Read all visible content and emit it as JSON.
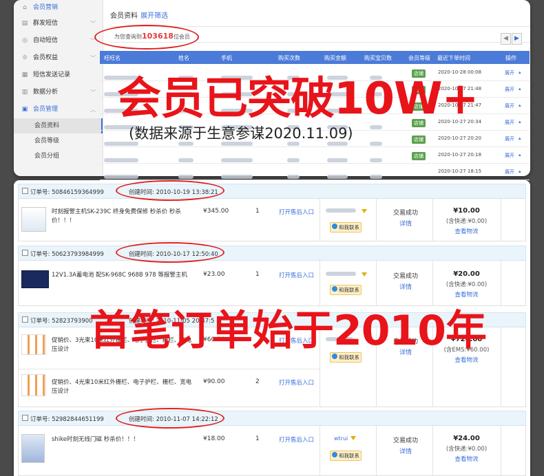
{
  "sidebar": {
    "items": [
      {
        "label": "会员营销",
        "icon": "home-icon"
      },
      {
        "label": "群发短信",
        "icon": "sms-icon"
      },
      {
        "label": "自动短信",
        "icon": "auto-sms-icon"
      },
      {
        "label": "会员权益",
        "icon": "rights-icon"
      },
      {
        "label": "短信发送记录",
        "icon": "record-icon"
      },
      {
        "label": "数据分析",
        "icon": "chart-icon"
      },
      {
        "label": "会员管理",
        "icon": "member-icon"
      }
    ],
    "subs": [
      "会员资料",
      "会员等级",
      "会员分组"
    ]
  },
  "main": {
    "title": "会员资料",
    "expand_filter": "展开筛选",
    "query_prefix": "为您查询到",
    "query_count": "103618",
    "query_suffix": "位会员"
  },
  "table": {
    "headers": [
      "旺旺名",
      "姓名",
      "手机",
      "购买次数",
      "购买金额",
      "购买宝贝数",
      "会员等级",
      "最近下单时间",
      "操作"
    ],
    "rows": [
      {
        "level": "店铺",
        "time": "2020-10-28 00:08",
        "op": "展开"
      },
      {
        "level": "店铺",
        "time": "2020-10-27 21:48",
        "op": "展开"
      },
      {
        "level": "店铺",
        "time": "2020-10-27 21:47",
        "op": "展开"
      },
      {
        "level": "店铺",
        "time": "2020-10-27 20:34",
        "op": "展开"
      },
      {
        "level": "店铺",
        "time": "2020-10-27 20:20",
        "op": "展开"
      },
      {
        "level": "店铺",
        "time": "2020-10-27 20:18",
        "op": "展开"
      },
      {
        "level": "",
        "time": "2020-10-27 18:15",
        "op": "展开"
      }
    ]
  },
  "overlay": {
    "headline": "会员已突破10W+",
    "source": "(数据来源于生意参谋2020.11.09)",
    "headline2": "首笔订单始于2010年"
  },
  "orders": [
    {
      "no_label": "订单号: 50846159364999",
      "time": "创建时间: 2010-10-19 13:38:21",
      "items": [
        {
          "title": "时刻报警主机SK-239C 终身免费保修 秒杀价 秒杀价！！！",
          "price": "¥345.00",
          "qty": "1",
          "after": "打开售后入口"
        }
      ],
      "contact": "和我联系",
      "status": "交易成功",
      "detail": "详情",
      "total": "¥10.00",
      "ship": "(含快递:¥0.00)",
      "logistics": "查看物流"
    },
    {
      "no_label": "订单号: 50623793984999",
      "time": "创建时间: 2010-10-17 12:50:40",
      "items": [
        {
          "title": "12V1.3A蓄电池 配SK-968C 968B 978 等报警主机",
          "price": "¥23.00",
          "qty": "1",
          "after": "打开售后入口"
        }
      ],
      "contact": "和我联系",
      "status": "交易成功",
      "detail": "详情",
      "total": "¥20.00",
      "ship": "(含快递:¥0.00)",
      "logistics": "查看物流"
    },
    {
      "no_label": "订单号: 52823793900",
      "time": "创建时间: 2010-11-05 20:47:5",
      "items": [
        {
          "title": "促销价、3光束10米红外栅栏、电子护栏、栅栏、宽电压设计",
          "price": "¥60.00",
          "qty": "",
          "after": "打开售后入口"
        },
        {
          "title": "促销价、4光束10米红外栅栏、电子护栏、栅栏、宽电压设计",
          "price": "¥90.00",
          "qty": "2",
          "after": "打开售后入口"
        }
      ],
      "contact": "和我联系",
      "status": "交易成功",
      "detail": "详情",
      "total": "¥720.00",
      "ship": "(含EMS:¥60.00)",
      "logistics": "查看物流"
    },
    {
      "no_label": "订单号: 52982844651199",
      "time": "创建时间: 2010-11-07 14:22:12",
      "items": [
        {
          "title": "shike时刻无线门磁 秒杀价！！！",
          "price": "¥18.00",
          "qty": "1",
          "after": "打开售后入口"
        }
      ],
      "buyer": "wtrui",
      "contact": "和我联系",
      "status": "交易成功",
      "detail": "详情",
      "total": "¥24.00",
      "ship": "(含快递:¥0.00)",
      "logistics": "查看物流"
    }
  ],
  "colors": {
    "accent": "#4b7bd8",
    "headline_red": "#e8141a",
    "ring_red": "#e02020"
  }
}
